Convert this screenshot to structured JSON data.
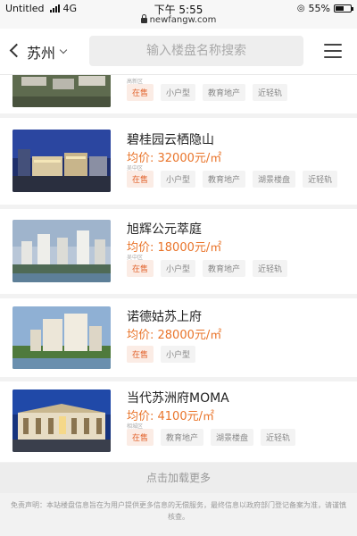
{
  "status_bar": {
    "carrier": "Untitled",
    "network": "4G",
    "time": "下午 5:55",
    "battery": "55%",
    "battery_level": 0.55,
    "url": "newfangw.com"
  },
  "header": {
    "back_icon": "back-arrow-icon",
    "city": "苏州",
    "search_placeholder": "输入楼盘名称搜索",
    "menu_icon": "hamburger-menu-icon"
  },
  "listings": [
    {
      "name": "",
      "price": "",
      "district": "高新区",
      "tags": [
        "在售",
        "小户型",
        "教育地产",
        "近轻轨"
      ]
    },
    {
      "name": "碧桂园云栖隐山",
      "price": "均价: 32000元/㎡",
      "district": "吴中区",
      "tags": [
        "在售",
        "小户型",
        "教育地产",
        "湖景楼盘",
        "近轻轨"
      ]
    },
    {
      "name": "旭辉公元萃庭",
      "price": "均价: 18000元/㎡",
      "district": "吴中区",
      "tags": [
        "在售",
        "小户型",
        "教育地产",
        "近轻轨"
      ]
    },
    {
      "name": "诺德姑苏上府",
      "price": "均价: 28000元/㎡",
      "district": "",
      "tags": [
        "在售",
        "小户型"
      ]
    },
    {
      "name": "当代苏洲府MOMA",
      "price": "均价: 4100元/㎡",
      "district": "相城区",
      "tags": [
        "在售",
        "教育地产",
        "湖景楼盘",
        "近轻轨"
      ]
    }
  ],
  "load_more": "点击加载更多",
  "disclaimer": "免责声明：本站楼盘信息旨在为用户提供更多信息的无偿服务，最终信息以政府部门登记备案为准，请谨慎核查。",
  "colors": {
    "accent": "#e9742a",
    "tag_hot_text": "#e2622b",
    "tag_hot_bg": "#fbece5"
  }
}
